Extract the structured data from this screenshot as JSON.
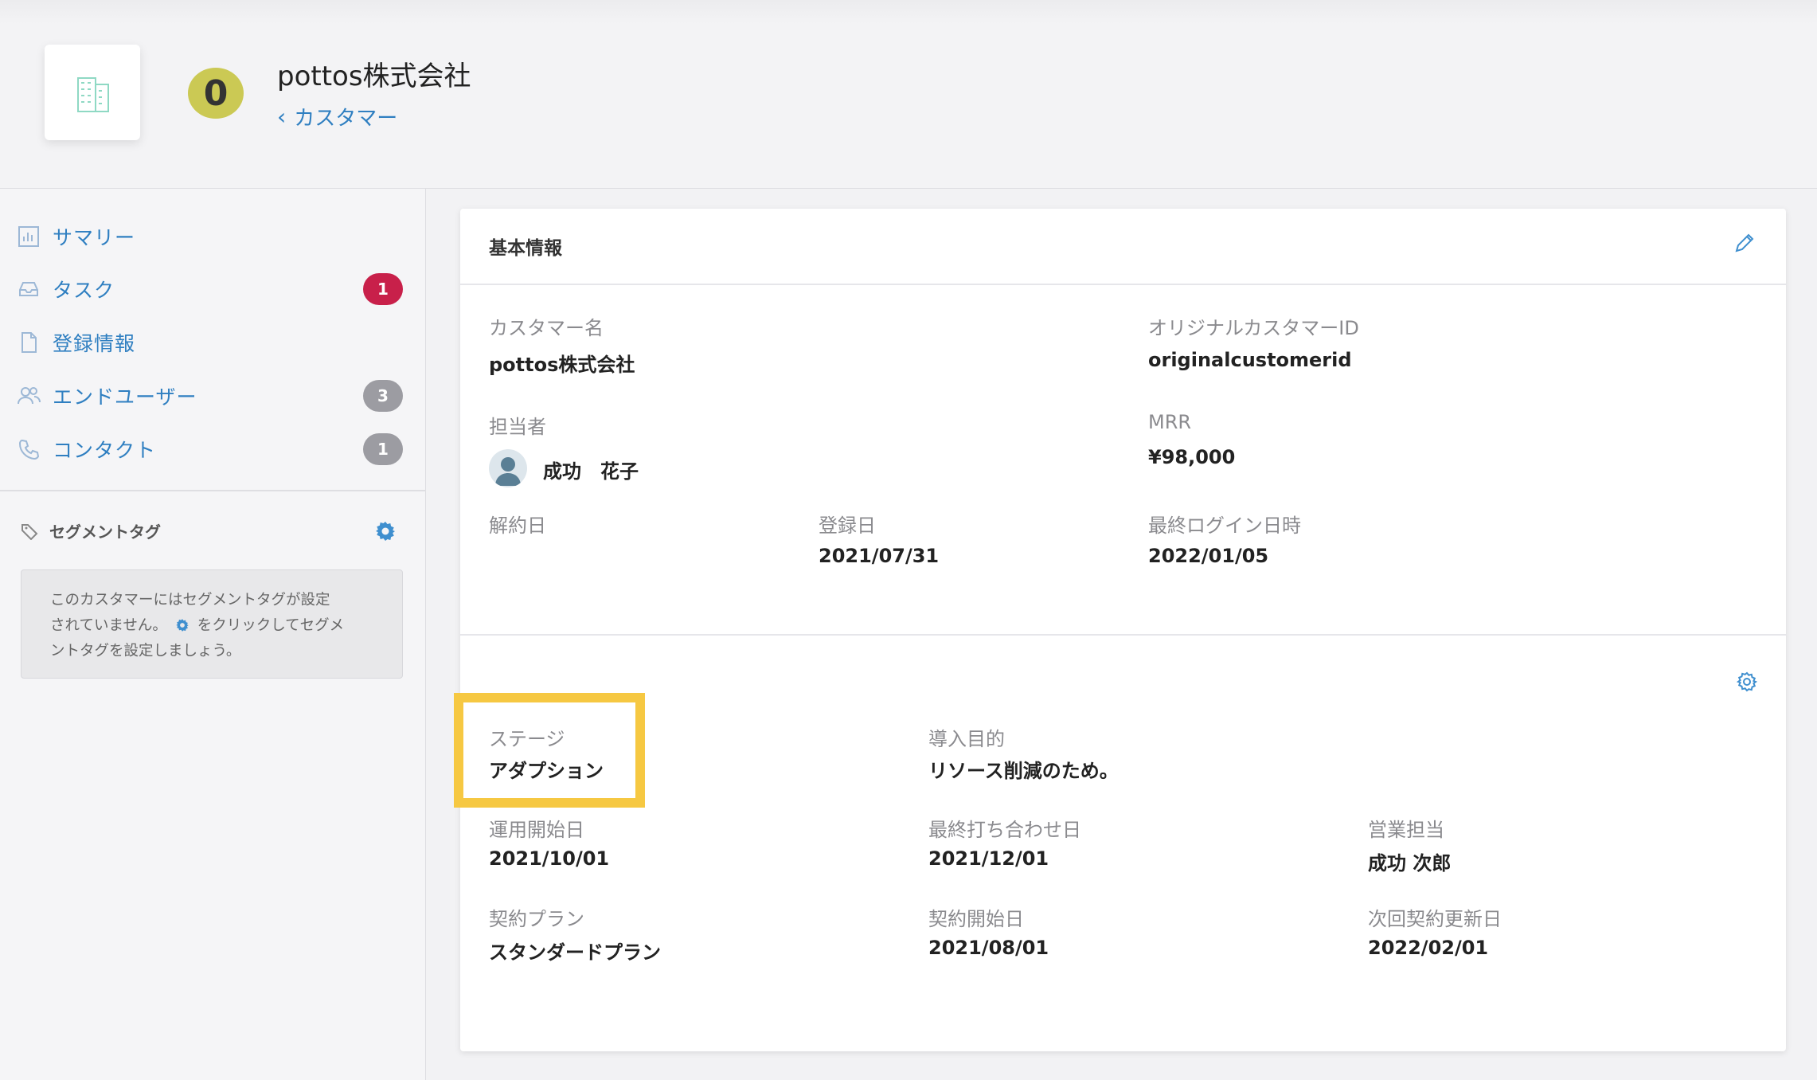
{
  "header": {
    "score": "0",
    "company_name": "pottos株式会社",
    "breadcrumb": "カスタマー"
  },
  "sidebar": {
    "items": [
      {
        "label": "サマリー",
        "icon": "bar-chart-icon",
        "badge": null
      },
      {
        "label": "タスク",
        "icon": "inbox-icon",
        "badge": "1",
        "badge_color": "#c8204a"
      },
      {
        "label": "登録情報",
        "icon": "document-icon",
        "badge": null
      },
      {
        "label": "エンドユーザー",
        "icon": "users-icon",
        "badge": "3",
        "badge_color": "#9c9ca2"
      },
      {
        "label": "コンタクト",
        "icon": "phone-icon",
        "badge": "1",
        "badge_color": "#9c9ca2"
      }
    ],
    "segment": {
      "title": "セグメントタグ",
      "empty_text_1": "このカスタマーにはセグメントタグが設定",
      "empty_text_2a": "されていません。",
      "empty_text_2b": "をクリックしてセグメ",
      "empty_text_3": "ントタグを設定しましょう。"
    }
  },
  "card": {
    "title": "基本情報",
    "fields": {
      "customer_name_label": "カスタマー名",
      "customer_name": "pottos株式会社",
      "original_id_label": "オリジナルカスタマーID",
      "original_id": "originalcustomerid",
      "owner_label": "担当者",
      "owner": "成功　花子",
      "mrr_label": "MRR",
      "mrr": "¥98,000",
      "cancel_label": "解約日",
      "registered_label": "登録日",
      "registered": "2021/07/31",
      "last_login_label": "最終ログイン日時",
      "last_login": "2022/01/05"
    },
    "custom": {
      "stage_label": "ステージ",
      "stage": "アダプション",
      "purpose_label": "導入目的",
      "purpose": "リソース削減のため。",
      "ops_start_label": "運用開始日",
      "ops_start": "2021/10/01",
      "last_meeting_label": "最終打ち合わせ日",
      "last_meeting": "2021/12/01",
      "sales_label": "営業担当",
      "sales": "成功 次郎",
      "plan_label": "契約プラン",
      "plan": "スタンダードプラン",
      "contract_start_label": "契約開始日",
      "contract_start": "2021/08/01",
      "renewal_label": "次回契約更新日",
      "renewal": "2022/02/01"
    }
  },
  "colors": {
    "accent": "#2f7fc1",
    "score_bg": "#cbc954",
    "highlight": "#f6c842"
  }
}
